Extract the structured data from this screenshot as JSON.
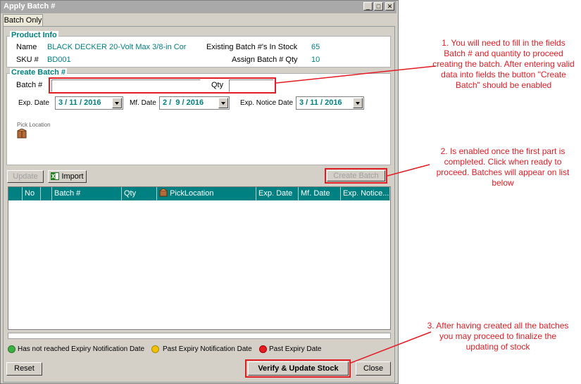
{
  "window": {
    "title": "Apply Batch #",
    "controls": [
      "_",
      "□",
      "✕"
    ]
  },
  "tab": {
    "label": "Batch Only"
  },
  "product_info": {
    "title": "Product Info",
    "name_label": "Name",
    "name_value": "BLACK  DECKER 20-Volt Max 3/8-in Cor",
    "sku_label": "SKU #",
    "sku_value": "BD001",
    "existing_label": "Existing Batch #'s In Stock",
    "existing_value": "65",
    "assign_label": "Assign Batch # Qty",
    "assign_value": "10"
  },
  "create_batch": {
    "title": "Create Batch #",
    "batch_label": "Batch #",
    "batch_value": "",
    "qty_label": "Qty",
    "qty_value": "",
    "exp_label": "Exp. Date",
    "exp_value": "3 / 11 / 2016",
    "mf_label": "Mf. Date",
    "mf_value": "2 /  9 / 2016",
    "notice_label": "Exp. Notice Date",
    "notice_value": "3 / 11 / 2016",
    "pick_label": "Pick Location"
  },
  "toolbar": {
    "update_label": "Update",
    "import_label": "Import",
    "create_batch_label": "Create Batch"
  },
  "grid": {
    "columns": [
      "No",
      "Batch #",
      "Qty",
      "PickLocation",
      "Exp. Date",
      "Mf. Date",
      "Exp. Notice..."
    ]
  },
  "legend": {
    "not_reached": "Has not reached Expiry Notification Date",
    "past_notification": "Past Expiry Notification Date",
    "past_expiry": "Past Expiry Date"
  },
  "footer": {
    "reset_label": "Reset",
    "verify_label": "Verify & Update Stock",
    "close_label": "Close"
  },
  "annotations": {
    "note1": "1. You will need to fill in the fields Batch # and quantity to proceed creating the batch. After entering valid data into fields the button \"Create Batch\" should be enabled",
    "note2": "2. Is enabled once the first part is completed. Click when ready to proceed. Batches will appear on list below",
    "note3": "3. After having created all the batches you may proceed to finalize the updating of stock"
  },
  "colors": {
    "accent": "#008080",
    "annotation": "#e31b23",
    "legend_green": "#3cb043",
    "legend_yellow": "#f2c200",
    "legend_red": "#e31b23"
  }
}
